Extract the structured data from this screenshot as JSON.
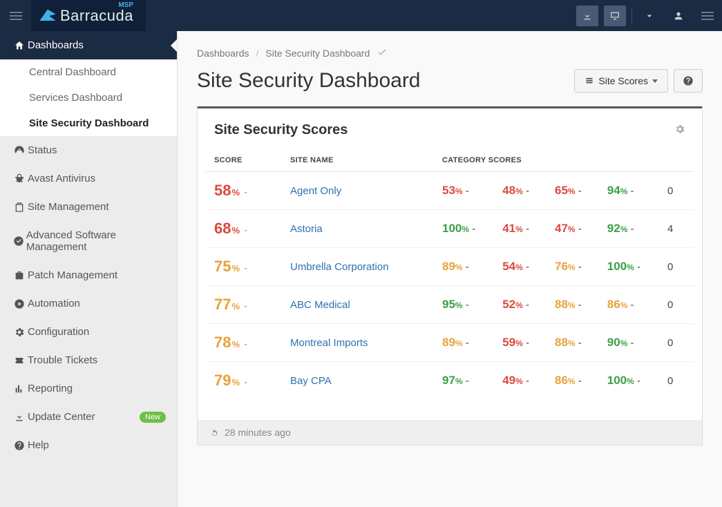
{
  "brand": {
    "name": "Barracuda",
    "suffix": "MSP"
  },
  "breadcrumb": {
    "root": "Dashboards",
    "current": "Site Security Dashboard"
  },
  "page": {
    "title": "Site Security Dashboard"
  },
  "actions": {
    "siteScores": "Site Scores"
  },
  "card": {
    "title": "Site Security Scores",
    "updated": "28 minutes ago"
  },
  "tableHeaders": {
    "score": "SCORE",
    "siteName": "SITE NAME",
    "categoryScores": "CATEGORY SCORES"
  },
  "sidebar": {
    "top": {
      "label": "Dashboards"
    },
    "sub": [
      {
        "label": "Central Dashboard"
      },
      {
        "label": "Services Dashboard"
      },
      {
        "label": "Site Security Dashboard"
      }
    ],
    "items": [
      {
        "label": "Status",
        "icon": "dashboard"
      },
      {
        "label": "Avast Antivirus",
        "icon": "bug"
      },
      {
        "label": "Site Management",
        "icon": "clipboard"
      },
      {
        "label": "Advanced Software Management",
        "icon": "check-circle"
      },
      {
        "label": "Patch Management",
        "icon": "briefcase"
      },
      {
        "label": "Automation",
        "icon": "play"
      },
      {
        "label": "Configuration",
        "icon": "cogs"
      },
      {
        "label": "Trouble Tickets",
        "icon": "ticket"
      },
      {
        "label": "Reporting",
        "icon": "chart"
      },
      {
        "label": "Update Center",
        "icon": "download",
        "badge": "New"
      },
      {
        "label": "Help",
        "icon": "help"
      }
    ]
  },
  "rows": [
    {
      "score": 58,
      "scoreColor": "red",
      "site": "Agent Only",
      "cats": [
        {
          "v": 53,
          "c": "red"
        },
        {
          "v": 48,
          "c": "red"
        },
        {
          "v": 65,
          "c": "red"
        },
        {
          "v": 94,
          "c": "green"
        }
      ],
      "last": 0
    },
    {
      "score": 68,
      "scoreColor": "red",
      "site": "Astoria",
      "cats": [
        {
          "v": 100,
          "c": "green"
        },
        {
          "v": 41,
          "c": "red"
        },
        {
          "v": 47,
          "c": "red"
        },
        {
          "v": 92,
          "c": "green"
        }
      ],
      "last": 4
    },
    {
      "score": 75,
      "scoreColor": "orange",
      "site": "Umbrella Corporation",
      "cats": [
        {
          "v": 89,
          "c": "orange"
        },
        {
          "v": 54,
          "c": "red"
        },
        {
          "v": 76,
          "c": "orange"
        },
        {
          "v": 100,
          "c": "green"
        }
      ],
      "last": 0
    },
    {
      "score": 77,
      "scoreColor": "orange",
      "site": "ABC Medical",
      "cats": [
        {
          "v": 95,
          "c": "green"
        },
        {
          "v": 52,
          "c": "red"
        },
        {
          "v": 88,
          "c": "orange"
        },
        {
          "v": 86,
          "c": "orange"
        }
      ],
      "last": 0
    },
    {
      "score": 78,
      "scoreColor": "orange",
      "site": "Montreal Imports",
      "cats": [
        {
          "v": 89,
          "c": "orange"
        },
        {
          "v": 59,
          "c": "red"
        },
        {
          "v": 88,
          "c": "orange"
        },
        {
          "v": 90,
          "c": "green"
        }
      ],
      "last": 0
    },
    {
      "score": 79,
      "scoreColor": "orange",
      "site": "Bay CPA",
      "cats": [
        {
          "v": 97,
          "c": "green"
        },
        {
          "v": 49,
          "c": "red"
        },
        {
          "v": 86,
          "c": "orange"
        },
        {
          "v": 100,
          "c": "green"
        }
      ],
      "last": 0
    }
  ]
}
